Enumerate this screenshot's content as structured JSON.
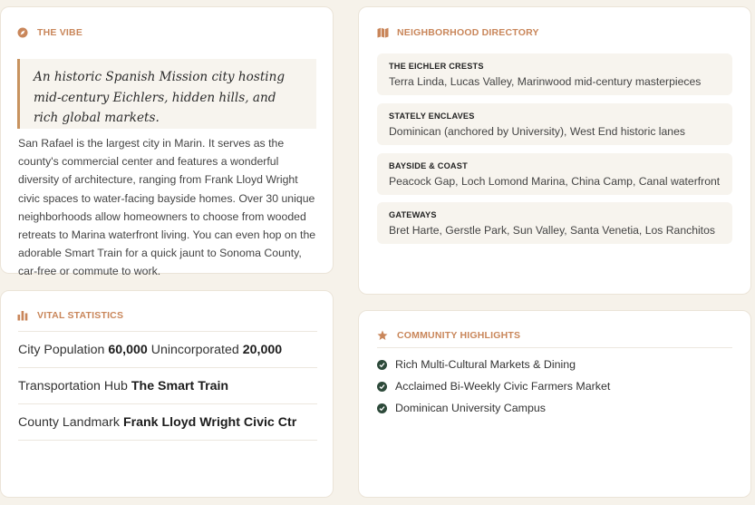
{
  "vibe": {
    "title": "THE VIBE",
    "quote": "An historic Spanish Mission city hosting mid-century Eichlers, hidden hills, and rich global markets.",
    "body": "San Rafael is the largest city in Marin. It serves as the county's commercial center and features a wonderful diversity of architecture, ranging from Frank Lloyd Wright civic spaces to water-facing bayside homes. Over 30 unique neighborhoods allow homeowners to choose from wooded retreats to Marina waterfront living. You can even hop on the adorable Smart Train for a quick jaunt to Sonoma County, car-free or commute to work."
  },
  "directory": {
    "title": "NEIGHBORHOOD DIRECTORY",
    "items": [
      {
        "heading": "THE EICHLER CRESTS",
        "value": "Terra Linda, Lucas Valley, Marinwood  mid-century masterpieces"
      },
      {
        "heading": "STATELY ENCLAVES",
        "value": "Dominican (anchored by University), West End historic lanes"
      },
      {
        "heading": "BAYSIDE & COAST",
        "value": "Peacock Gap, Loch Lomond Marina, China Camp, Canal waterfront"
      },
      {
        "heading": "GATEWAYS",
        "value": "Bret Harte, Gerstle Park, Sun Valley, Santa Venetia, Los Ranchitos"
      }
    ]
  },
  "stats": {
    "title": "VITAL STATISTICS",
    "rows": [
      {
        "label1": "City Population",
        "value1": "60,000",
        "label2": "Unincorporated",
        "value2": "20,000"
      },
      {
        "label1": "Transportation Hub",
        "value1": "The Smart Train"
      },
      {
        "label1": "County Landmark",
        "value1": "Frank Lloyd Wright Civic Ctr"
      }
    ]
  },
  "highlights": {
    "title": "COMMUNITY HIGHLIGHTS",
    "items": [
      "Rich Multi-Cultural Markets & Dining",
      "Acclaimed Bi-Weekly Civic Farmers Market",
      "Dominican University Campus"
    ]
  },
  "colors": {
    "accent": "#c9865a",
    "check": "#2d4a3a",
    "background": "#f6f2ea"
  },
  "icons": {
    "vibe": "compass-icon",
    "directory": "map-icon",
    "stats": "bar-chart-icon",
    "highlights": "star-icon",
    "check": "check-circle-icon"
  }
}
